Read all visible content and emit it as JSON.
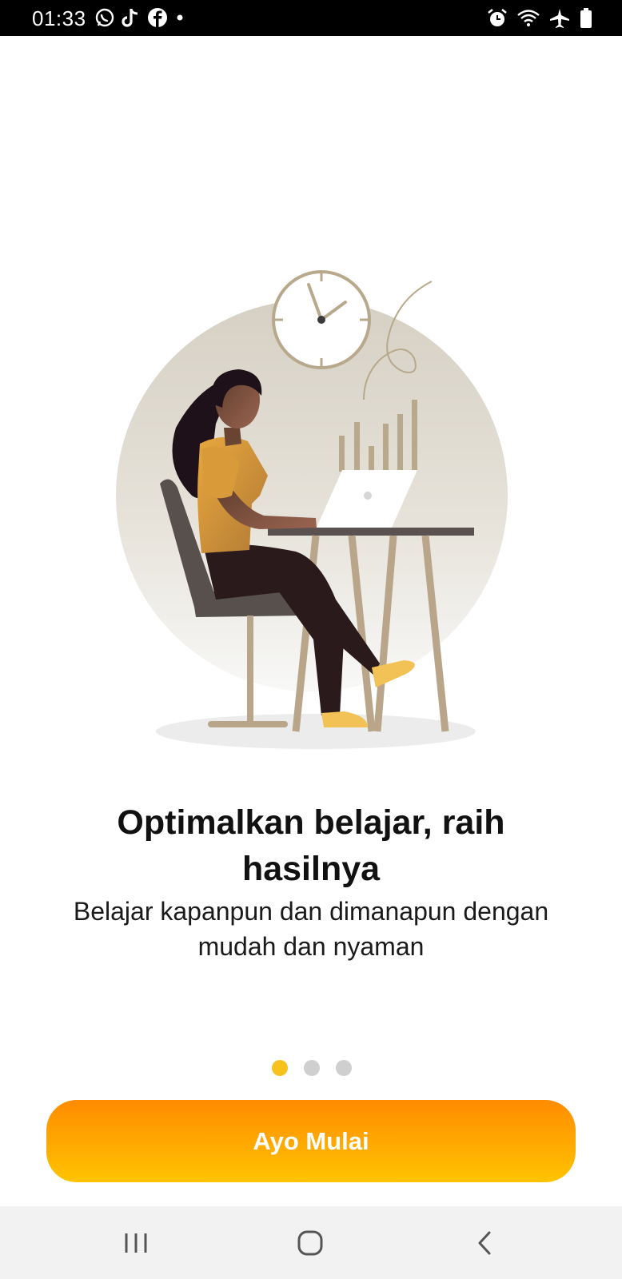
{
  "status_bar": {
    "time": "01:33",
    "left_icons": [
      "whatsapp-icon",
      "tiktok-icon",
      "facebook-icon",
      "dot-icon"
    ],
    "right_icons": [
      "alarm-icon",
      "wifi-icon",
      "airplane-icon",
      "battery-icon"
    ]
  },
  "onboarding": {
    "title": "Optimalkan belajar, raih hasilnya",
    "subtitle": "Belajar kapanpun dan dimanapun dengan mudah dan nyaman",
    "page_count": 3,
    "active_page": 1
  },
  "cta": {
    "label": "Ayo Mulai"
  },
  "colors": {
    "accent_orange": "#ff8c00",
    "accent_yellow": "#ffc400",
    "dot_active": "#f7c21b",
    "dot_inactive": "#cfcfcf"
  },
  "nav_bar": {
    "items": [
      "recent-apps-icon",
      "home-icon",
      "back-icon"
    ]
  }
}
